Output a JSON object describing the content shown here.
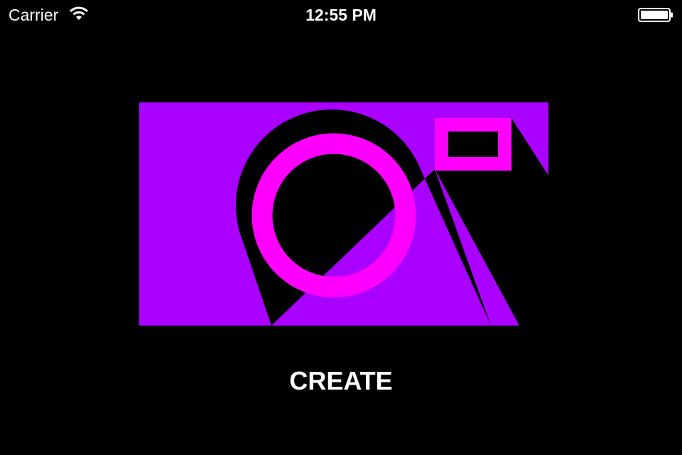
{
  "status_bar": {
    "carrier": "Carrier",
    "time": "12:55 PM",
    "wifi_icon": "wifi-icon",
    "battery_icon": "battery-icon"
  },
  "logo": {
    "icon": "camera-icon",
    "colors": {
      "body": "#aa00ff",
      "lens": "#ff00ff",
      "cutout": "#000000"
    }
  },
  "main": {
    "create_label": "CREATE"
  },
  "colors": {
    "background": "#000000",
    "text": "#ffffff"
  }
}
